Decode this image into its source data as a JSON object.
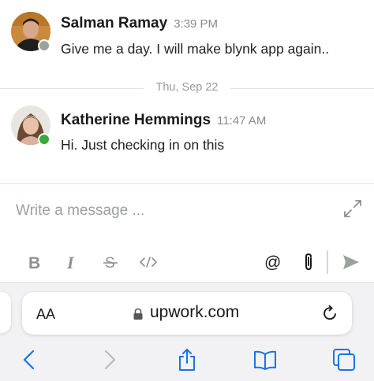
{
  "messages": [
    {
      "sender": "Salman Ramay",
      "time": "3:39 PM",
      "text": "Give me a day. I will make blynk app again..",
      "status": "offline"
    },
    {
      "sender": "Katherine Hemmings",
      "time": "11:47 AM",
      "text": "Hi. Just checking in on this",
      "status": "online"
    }
  ],
  "date_divider": "Thu, Sep 22",
  "composer": {
    "placeholder": "Write a message ...",
    "tools": [
      "bold-icon",
      "italic-icon",
      "strikethrough-icon",
      "code-icon",
      "mention-icon",
      "attach-icon",
      "send-icon"
    ]
  },
  "browser": {
    "text_size_label": "AA",
    "url": "upwork.com",
    "nav": [
      "back-icon",
      "forward-icon",
      "share-icon",
      "bookmarks-icon",
      "tabs-icon"
    ]
  },
  "colors": {
    "online": "#3aa83a",
    "offline": "#9aa29a",
    "ios_blue": "#1a73e8",
    "muted": "#8f8f8f"
  }
}
